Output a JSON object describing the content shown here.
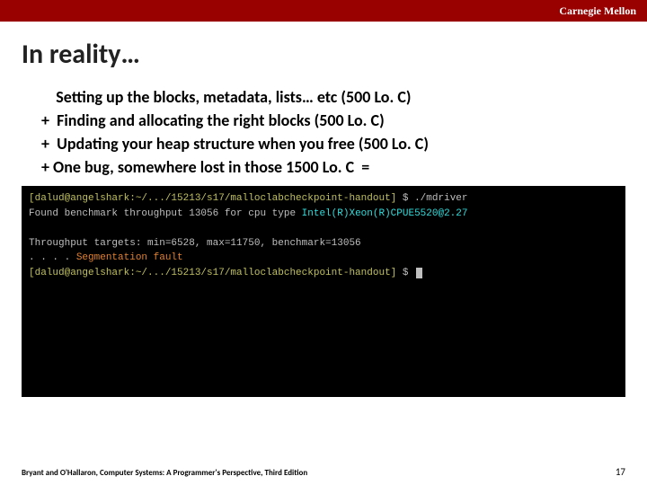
{
  "brand": "Carnegie Mellon",
  "title": "In reality…",
  "bullets": {
    "l1": "    Setting up the blocks, metadata, lists… etc (500 Lo. C)",
    "l2": "+  Finding and allocating the right blocks (500 Lo. C)",
    "l3": "+  Updating your heap structure when you free (500 Lo. C)",
    "l4": "+ One bug, somewhere lost in those 1500 Lo. C  ="
  },
  "terminal": {
    "prompt1": "[dalud@angelshark:~/.../15213/s17/malloclabcheckpoint-handout]",
    "cmd1": " $ ./mdriver",
    "line2a": "Found benchmark throughput 13056 for cpu type ",
    "line2b": "Intel(R)Xeon(R)CPUE5520@2.27",
    "blank": " ",
    "line3": "Throughput targets: min=6528, max=11750, benchmark=13056",
    "dots": ". . . . ",
    "fault": "Segmentation fault",
    "prompt2": "[dalud@angelshark:~/.../15213/s17/malloclabcheckpoint-handout]",
    "cmd2": " $ "
  },
  "footer": {
    "attr": "Bryant and O'Hallaron, Computer Systems: A Programmer's Perspective, Third Edition",
    "page": "17"
  }
}
